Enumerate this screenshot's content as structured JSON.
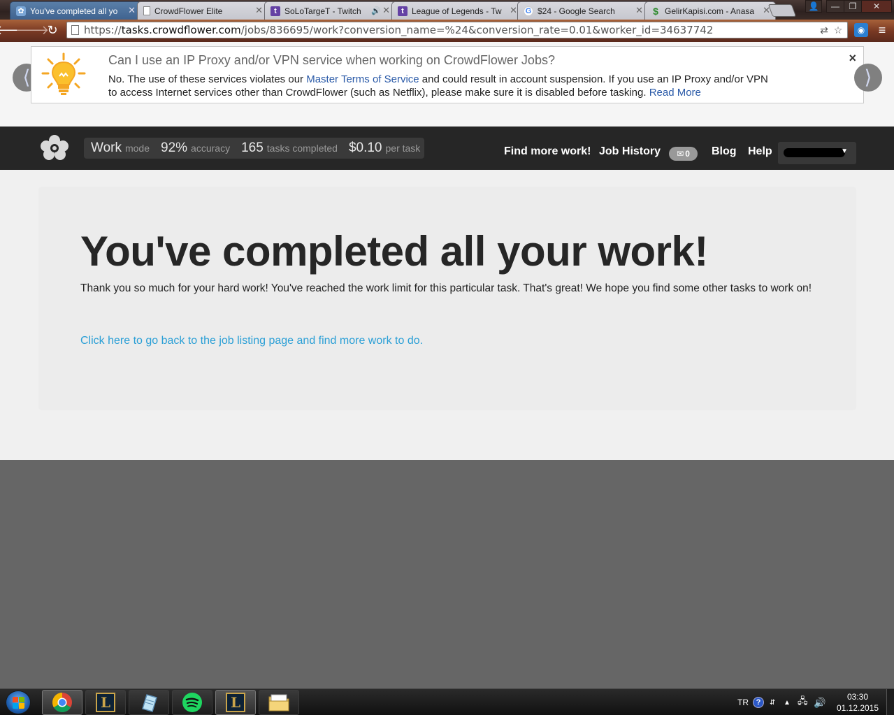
{
  "browser": {
    "tabs": [
      {
        "title": "You've completed all yo",
        "icon": "crowdflower",
        "active": true
      },
      {
        "title": "CrowdFlower Elite",
        "icon": "doc"
      },
      {
        "title": "SoLoTargeT - Twitch",
        "icon": "twitch",
        "audio": "🔊"
      },
      {
        "title": "League of Legends - Tw",
        "icon": "twitch"
      },
      {
        "title": "$24 - Google Search",
        "icon": "google"
      },
      {
        "title": "GelirKapisi.com - Anasa",
        "icon": "dollar"
      }
    ],
    "url_scheme": "https://",
    "url_host": "tasks.crowdflower.com",
    "url_path": "/jobs/836695/work?conversion_name=%24&conversion_rate=0.01&worker_id=34637742",
    "ext_label": "◉"
  },
  "announcement": {
    "question": "Can I use an IP Proxy and/or VPN service when working on CrowdFlower Jobs?",
    "answer_pre": "No. The use of these services violates our ",
    "answer_link": "Master Terms of Service",
    "answer_post": " and could result in account suspension. If you use an IP Proxy and/or VPN to access Internet services other than CrowdFlower (such as Netflix), please make sure it is disabled before tasking. ",
    "read_more": "Read More",
    "close": "×",
    "prev": "⟨",
    "next": "⟩"
  },
  "header": {
    "mode_value": "Work",
    "mode_label": "mode",
    "accuracy_value": "92%",
    "accuracy_label": "accuracy",
    "tasks_value": "165",
    "tasks_label": "tasks completed",
    "pay_value": "$0.10",
    "pay_label": "per task",
    "nav": {
      "find_work": "Find more work!",
      "job_history": "Job History",
      "messages_count": "0",
      "blog": "Blog",
      "help": "Help"
    }
  },
  "main": {
    "headline": "You've completed all your work!",
    "thanks": "Thank you so much for your hard work! You've reached the work limit for this particular task. That's great! We hope you find some other tasks to work on!",
    "back_link": "Click here to go back to the job listing page and find more work to do."
  },
  "taskbar": {
    "lang": "TR",
    "time": "03:30",
    "date": "01.12.2015"
  },
  "colors": {
    "link": "#2a9fd6",
    "header_bg": "#262626",
    "active_tab": "#3f6390"
  }
}
